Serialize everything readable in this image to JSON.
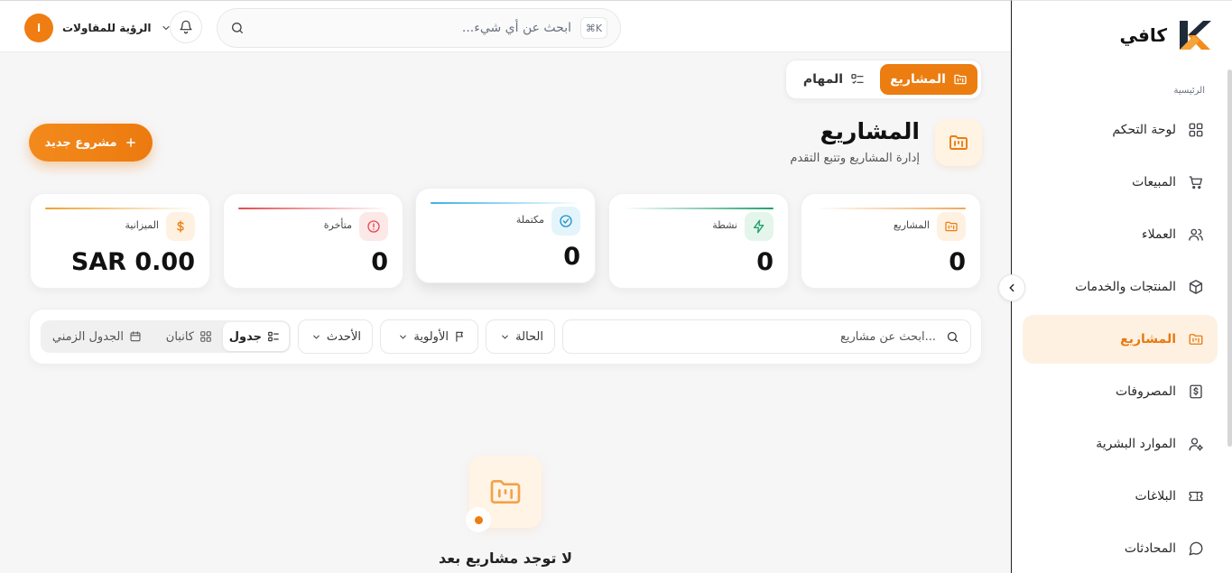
{
  "brand": {
    "name": "كافي"
  },
  "sidebar": {
    "section_label": "الرئيسية",
    "items": [
      {
        "label": "لوحة التحكم",
        "icon": "grid-icon"
      },
      {
        "label": "المبيعات",
        "icon": "cart-icon"
      },
      {
        "label": "العملاء",
        "icon": "users-icon"
      },
      {
        "label": "المنتجات والخدمات",
        "icon": "box-icon"
      },
      {
        "label": "المشاريع",
        "icon": "folder-kanban-icon",
        "active": true
      },
      {
        "label": "المصروفات",
        "icon": "receipt-dollar-icon"
      },
      {
        "label": "الموارد البشرية",
        "icon": "user-cog-icon"
      },
      {
        "label": "البلاغات",
        "icon": "ticket-icon"
      },
      {
        "label": "المحادثات",
        "icon": "chat-icon"
      }
    ]
  },
  "topbar": {
    "search_placeholder": "...ابحث عن أي شيء",
    "shortcut": "⌘K",
    "company_name": "الرؤية للمقاولات",
    "company_initial": "ا"
  },
  "switch": {
    "projects": "المشاريع",
    "tasks": "المهام"
  },
  "header": {
    "title": "المشاريع",
    "subtitle": "إدارة المشاريع وتتبع التقدم",
    "new_button": "مشروع جديد"
  },
  "stats": [
    {
      "label": "المشاريع",
      "value": "0",
      "color": "#f2a65a",
      "icon": "folder-kanban-icon"
    },
    {
      "label": "نشطة",
      "value": "0",
      "color": "#22a06b",
      "icon": "bolt-icon"
    },
    {
      "label": "مكتملة",
      "value": "0",
      "color": "#38b2e8",
      "icon": "check-circle-icon"
    },
    {
      "label": "متأخرة",
      "value": "0",
      "color": "#e5484d",
      "icon": "alert-circle-icon"
    },
    {
      "label": "الميزانية",
      "value": "SAR 0.00",
      "color": "#f0a12b",
      "icon": "dollar-icon"
    }
  ],
  "filters": {
    "search_placeholder": "ابحث عن مشاريع...",
    "status": "الحالة",
    "priority": "الأولوية",
    "sort": "الأحدث",
    "views": {
      "table": "جدول",
      "kanban": "كانبان",
      "timeline": "الجدول الزمني"
    }
  },
  "empty": {
    "title": "لا توجد مشاريع بعد"
  },
  "colors": {
    "accent": "#ec7d10",
    "accent_light": "#fff1e2"
  }
}
